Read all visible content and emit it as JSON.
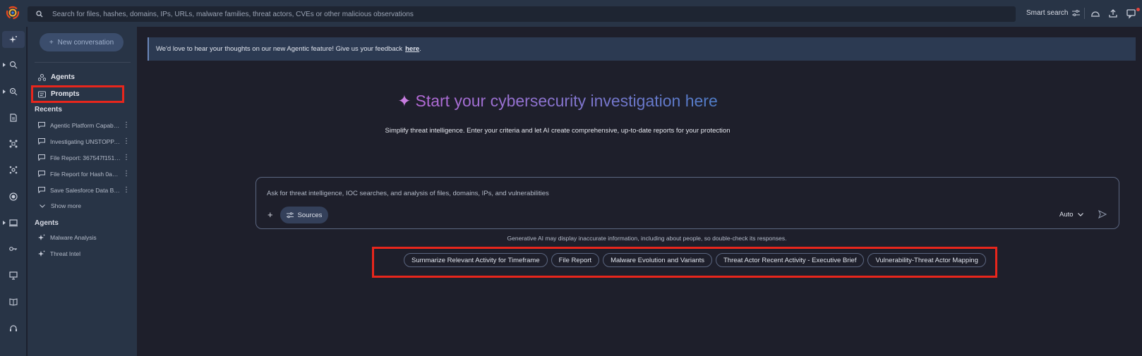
{
  "topbar": {
    "search_placeholder": "Search for files, hashes, domains, IPs, URLs, malware families, threat actors, CVEs or other malicious observations",
    "smart_search_label": "Smart search"
  },
  "sidebar": {
    "new_conversation_label": "New conversation",
    "nav": [
      {
        "label": "Agents",
        "icon": "agents-icon"
      },
      {
        "label": "Prompts",
        "icon": "prompts-icon"
      }
    ],
    "recents_heading": "Recents",
    "recents": [
      "Agentic Platform Capabil...",
      "Investigating UNSTOPPA...",
      "File Report: 367547f1513...",
      "File Report for Hash 0a03...",
      "Save Salesforce Data Bre..."
    ],
    "show_more_label": "Show more",
    "agents_heading": "Agents",
    "agents": [
      "Malware Analysis",
      "Threat Intel"
    ]
  },
  "main": {
    "banner_text": "We'd love to hear your thoughts on our new Agentic feature! Give us your feedback",
    "banner_link": "here",
    "banner_tail": ".",
    "hero_star": "✦",
    "hero_title": "Start your cybersecurity investigation here",
    "subtitle": "Simplify threat intelligence. Enter your criteria and let AI create comprehensive, up-to-date reports for your protection",
    "prompt_placeholder": "Ask for threat intelligence, IOC searches, and analysis of files, domains, IPs, and vulnerabilities",
    "sources_label": "Sources",
    "model_label": "Auto",
    "disclaimer": "Generative AI may display inaccurate information, including about people, so double-check its responses.",
    "suggestions": [
      "Summarize Relevant Activity for Timeframe",
      "File Report",
      "Malware Evolution and Variants",
      "Threat Actor Recent Activity - Executive Brief",
      "Vulnerability-Threat Actor Mapping"
    ]
  },
  "colors": {
    "highlight_box": "#e8261c",
    "hero_gradient_start": "#b46ad6",
    "hero_gradient_end": "#4f7cc7",
    "notification_dot": "#e0443d"
  }
}
